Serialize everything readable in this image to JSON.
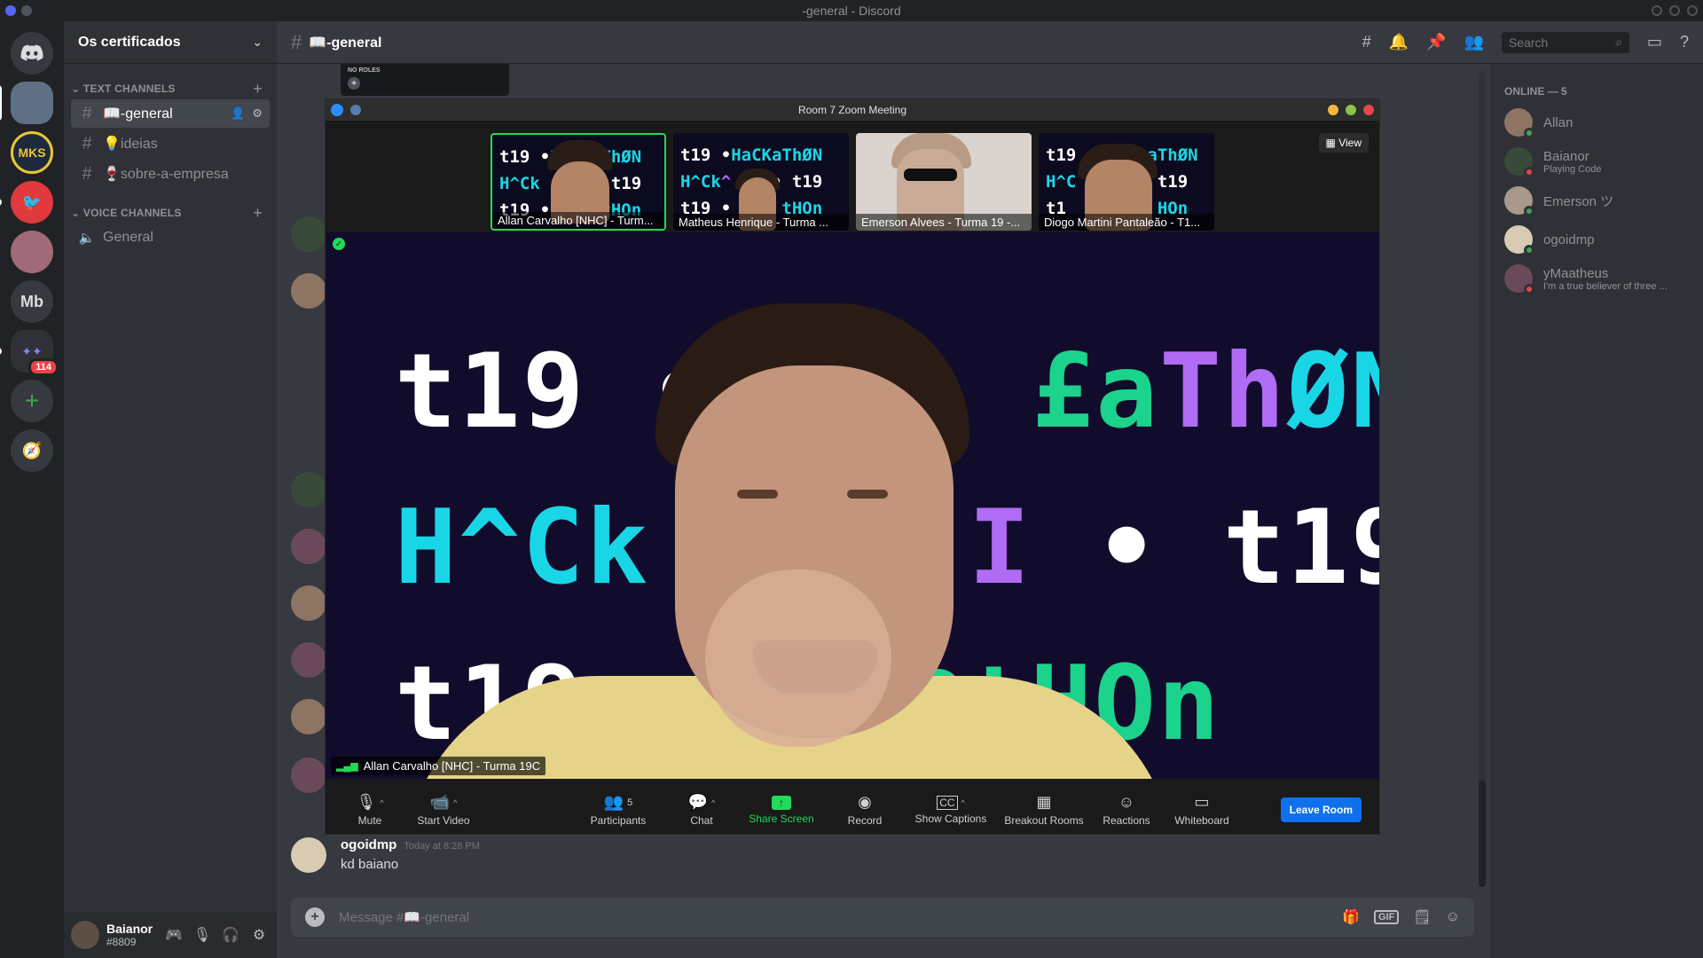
{
  "window": {
    "title": "-general - Discord"
  },
  "servers": [
    {
      "label": "",
      "icon": "discord-home-icon"
    },
    {
      "label": "",
      "icon": "server-avatar"
    },
    {
      "label": "MKS",
      "icon": ""
    },
    {
      "label": "",
      "icon": "server-red-bird"
    },
    {
      "label": "",
      "icon": "server-anime"
    },
    {
      "label": "Mb",
      "icon": ""
    },
    {
      "label": "",
      "icon": "server-folder",
      "badge": "114"
    }
  ],
  "guild": {
    "name": "Os certificados"
  },
  "sidebar": {
    "text_category": "TEXT CHANNELS",
    "voice_category": "VOICE CHANNELS",
    "text_channels": [
      {
        "label": "📖-general"
      },
      {
        "label": "💡ideias"
      },
      {
        "label": "🍷sobre-a-empresa"
      }
    ],
    "voice_channels": [
      {
        "label": "General"
      }
    ]
  },
  "user": {
    "name": "Baianor",
    "tag": "#8809"
  },
  "header": {
    "channel": "📖-general",
    "search_placeholder": "Search"
  },
  "roles_popup": {
    "label": "NO ROLES"
  },
  "zoom": {
    "title": "Room 7 Zoom Meeting",
    "view_label": "View",
    "tiles": [
      {
        "name": "Allan Carvalho [NHC] - Turm..."
      },
      {
        "name": "Matheus Henrique - Turma ..."
      },
      {
        "name": "Emerson Alvees - Turma 19 -..."
      },
      {
        "name": "Diogo Martini Pantaleão - T1..."
      }
    ],
    "speaker_name": "Allan Carvalho [NHC] - Turma 19C",
    "toolbar": {
      "mute": "Mute",
      "start_video": "Start Video",
      "participants": "Participants",
      "participants_count": "5",
      "chat": "Chat",
      "share_screen": "Share Screen",
      "record": "Record",
      "show_captions": "Show Captions",
      "breakout_rooms": "Breakout Rooms",
      "reactions": "Reactions",
      "whiteboard": "Whiteboard",
      "leave": "Leave Room"
    }
  },
  "last_message": {
    "author": "ogoidmp",
    "timestamp": "Today at 8:28 PM",
    "text": "kd baiano"
  },
  "composer": {
    "placeholder": "Message #📖-general"
  },
  "members": {
    "category": "ONLINE — 5",
    "list": [
      {
        "name": "Allan",
        "activity": ""
      },
      {
        "name": "Baianor",
        "activity": "Playing Code"
      },
      {
        "name": "Emerson ツ",
        "activity": ""
      },
      {
        "name": "ogoidmp",
        "activity": ""
      },
      {
        "name": "yMaatheus",
        "activity": "I'm a true believer of three ..."
      }
    ]
  },
  "colors": {
    "accent": "#5865f2",
    "online": "#3ba55d",
    "dnd": "#ed4245",
    "zoom_green": "#23d959",
    "zoom_blue": "#0e71eb"
  }
}
